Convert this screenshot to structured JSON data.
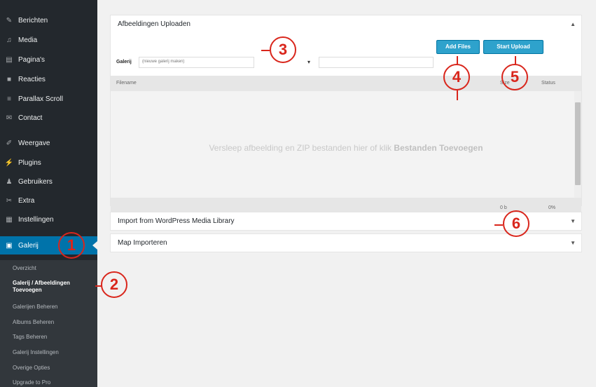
{
  "sidebar": {
    "items": [
      {
        "label": "Berichten",
        "icon": "pin-icon"
      },
      {
        "label": "Media",
        "icon": "media-icon"
      },
      {
        "label": "Pagina's",
        "icon": "pages-icon"
      },
      {
        "label": "Reacties",
        "icon": "comments-icon"
      },
      {
        "label": "Parallax Scroll",
        "icon": "parallax-icon"
      },
      {
        "label": "Contact",
        "icon": "mail-icon"
      },
      {
        "label": "Weergave",
        "icon": "brush-icon"
      },
      {
        "label": "Plugins",
        "icon": "plugin-icon"
      },
      {
        "label": "Gebruikers",
        "icon": "users-icon"
      },
      {
        "label": "Extra",
        "icon": "wrench-icon"
      },
      {
        "label": "Instellingen",
        "icon": "settings-icon"
      },
      {
        "label": "Galerij",
        "icon": "gallery-icon",
        "active": true
      }
    ],
    "submenu": [
      {
        "label": "Overzicht"
      },
      {
        "label": "Galerij / Afbeeldingen",
        "label2": "Toevoegen",
        "current": true
      },
      {
        "label": "Galerijen Beheren"
      },
      {
        "label": "Albums Beheren"
      },
      {
        "label": "Tags Beheren"
      },
      {
        "label": "Galerij Instellingen"
      },
      {
        "label": "Overige Opties"
      },
      {
        "label": "Upgrade to Pro"
      }
    ]
  },
  "upload_box": {
    "title": "Afbeeldingen Uploaden",
    "toggle": "▲",
    "gallery_label": "Galerij",
    "gallery_select_value": "(nieuwe galerij maken)",
    "chevron": "▾",
    "add_files": "Add Files",
    "start_upload": "Start Upload",
    "columns": {
      "filename": "Filename",
      "size": "Size",
      "status": "Status"
    },
    "drop_text": "Versleep afbeelding en ZIP bestanden hier of klik",
    "drop_link": "Bestanden Toevoegen",
    "footer_size": "0 b",
    "footer_status": "0%"
  },
  "import_box": {
    "title": "Import from WordPress Media Library",
    "toggle": "▼"
  },
  "map_box": {
    "title": "Map Importeren",
    "toggle": "▼"
  },
  "callouts": [
    "1",
    "2",
    "3",
    "4",
    "5",
    "6"
  ],
  "colors": {
    "sidebar": "#23282d",
    "submenu": "#32373c",
    "active": "#0073aa",
    "button": "#2ea2cc",
    "callout": "#d9261c"
  }
}
